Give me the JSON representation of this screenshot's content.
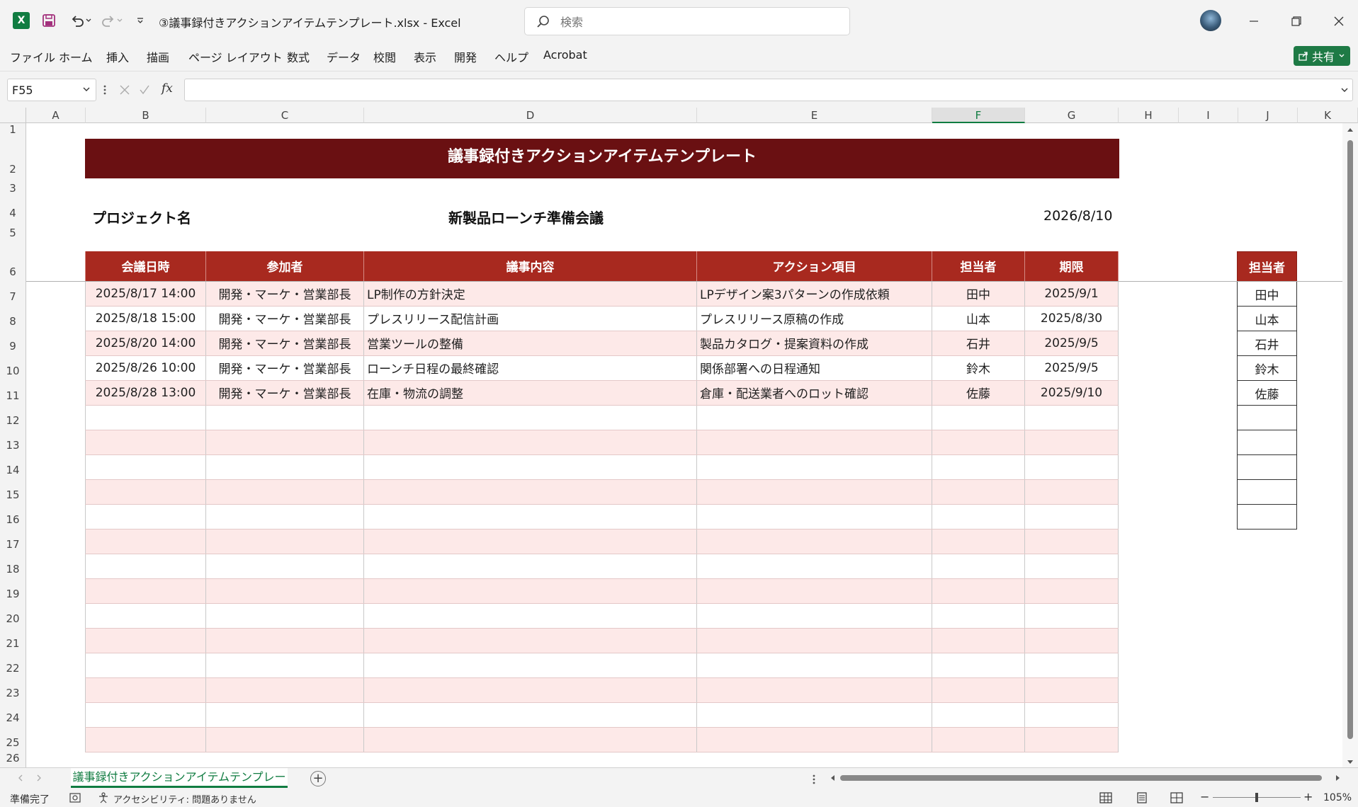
{
  "app": {
    "title": "③議事録付きアクションアイテムテンプレート.xlsx  -  Excel",
    "search_placeholder": "検索",
    "share_label": "共有"
  },
  "menu": [
    "ファイル",
    "ホーム",
    "挿入",
    "描画",
    "ページ レイアウト",
    "数式",
    "データ",
    "校閲",
    "表示",
    "開発",
    "ヘルプ",
    "Acrobat"
  ],
  "formula_bar": {
    "name_box": "F55",
    "fx": "fx",
    "formula": ""
  },
  "columns": [
    "A",
    "B",
    "C",
    "D",
    "E",
    "F",
    "G",
    "H",
    "I",
    "J",
    "K"
  ],
  "selected_column": "F",
  "rows": [
    "1",
    "2",
    "3",
    "4",
    "5",
    "6",
    "7",
    "8",
    "9",
    "10",
    "11",
    "12",
    "13",
    "14",
    "15",
    "16",
    "17",
    "18",
    "19",
    "20",
    "21",
    "22",
    "23",
    "24",
    "25",
    "26"
  ],
  "sheet": {
    "title": "議事録付きアクションアイテムテンプレート",
    "project_label": "プロジェクト名",
    "project_name": "新製品ローンチ準備会議",
    "date": "2026/8/10",
    "headers": [
      "会議日時",
      "参加者",
      "議事内容",
      "アクション項目",
      "担当者",
      "期限"
    ],
    "items": [
      {
        "datetime": "2025/8/17 14:00",
        "participants": "開発・マーケ・営業部長",
        "minutes": "LP制作の方針決定",
        "action": "LPデザイン案3パターンの作成依頼",
        "owner": "田中",
        "deadline": "2025/9/1"
      },
      {
        "datetime": "2025/8/18 15:00",
        "participants": "開発・マーケ・営業部長",
        "minutes": "プレスリリース配信計画",
        "action": "プレスリリース原稿の作成",
        "owner": "山本",
        "deadline": "2025/8/30"
      },
      {
        "datetime": "2025/8/20 14:00",
        "participants": "開発・マーケ・営業部長",
        "minutes": "営業ツールの整備",
        "action": "製品カタログ・提案資料の作成",
        "owner": "石井",
        "deadline": "2025/9/5"
      },
      {
        "datetime": "2025/8/26 10:00",
        "participants": "開発・マーケ・営業部長",
        "minutes": "ローンチ日程の最終確認",
        "action": "関係部署への日程通知",
        "owner": "鈴木",
        "deadline": "2025/9/5"
      },
      {
        "datetime": "2025/8/28 13:00",
        "participants": "開発・マーケ・営業部長",
        "minutes": "在庫・物流の調整",
        "action": "倉庫・配送業者へのロット確認",
        "owner": "佐藤",
        "deadline": "2025/9/10"
      }
    ],
    "side_header": "担当者",
    "side_list": [
      "田中",
      "山本",
      "石井",
      "鈴木",
      "佐藤",
      "",
      "",
      "",
      "",
      ""
    ]
  },
  "tabs": {
    "active": "議事録付きアクションアイテムテンプレート",
    "add": "+"
  },
  "status": {
    "ready": "準備完了",
    "accessibility": "アクセシビリティ: 問題ありません",
    "zoom": "105%"
  }
}
